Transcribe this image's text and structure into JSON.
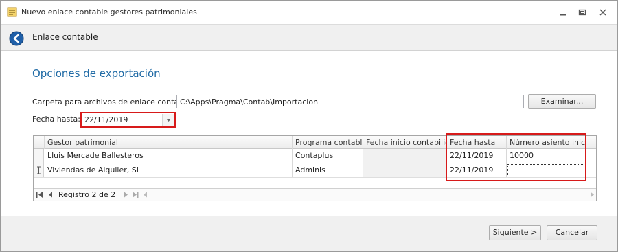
{
  "window": {
    "title": "Nuevo enlace contable gestores patrimoniales"
  },
  "header": {
    "title": "Enlace contable"
  },
  "main": {
    "section_title": "Opciones de exportación",
    "folder_label": "Carpeta para archivos de enlace contable:",
    "folder_value": "C:\\Apps\\Pragma\\Contab\\Importacion",
    "browse_label": "Examinar...",
    "date_label": "Fecha hasta:",
    "date_value": "22/11/2019"
  },
  "grid": {
    "columns": [
      "Gestor patrimonial",
      "Programa contable",
      "Fecha inicio contabilidad",
      "Fecha hasta",
      "Número asiento inicial"
    ],
    "rows": [
      {
        "gestor": "Lluis Mercade Ballesteros",
        "programa": "Contaplus",
        "fecha_inicio": "",
        "fecha_hasta": "22/11/2019",
        "asiento": "10000"
      },
      {
        "gestor": "Viviendas de Alquiler, SL",
        "programa": "Adminis",
        "fecha_inicio": "",
        "fecha_hasta": "22/11/2019",
        "asiento": ""
      }
    ],
    "navigator_text": "Registro 2 de 2"
  },
  "footer": {
    "next_label": "Siguiente >",
    "cancel_label": "Cancelar"
  },
  "colors": {
    "accent": "#1f6aa5",
    "highlight": "#d71a1a"
  },
  "icons": [
    "app-icon",
    "minimize-icon",
    "restore-icon",
    "close-icon",
    "back-arrow-icon",
    "dropdown-arrow-icon",
    "row-cursor-icon",
    "first-record-icon",
    "prev-record-icon",
    "next-record-icon",
    "last-record-icon"
  ]
}
